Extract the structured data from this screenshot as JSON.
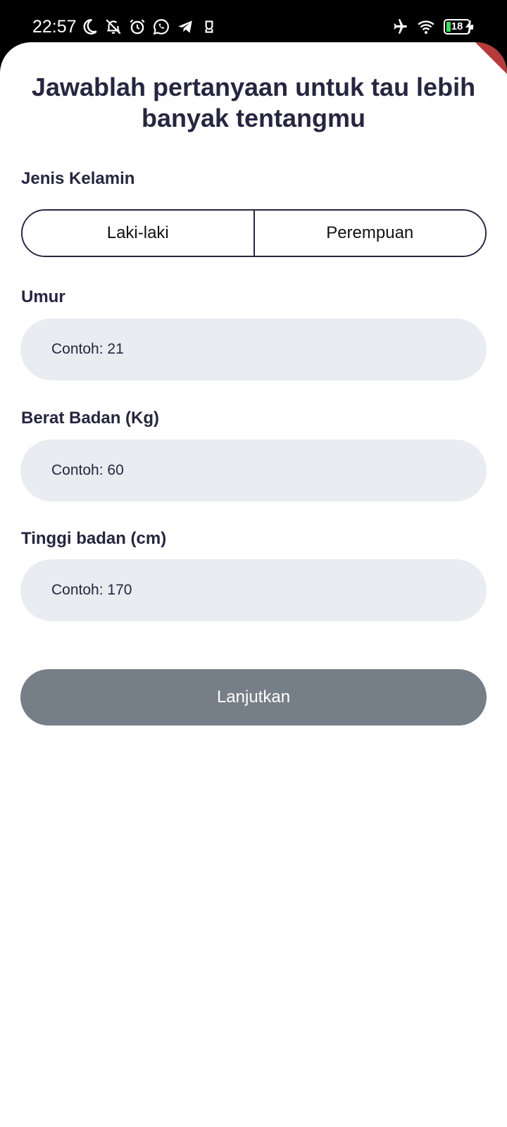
{
  "status_bar": {
    "time": "22:57",
    "left_icons": [
      "moon-icon",
      "bell-off-icon",
      "alarm-icon",
      "whatsapp-icon",
      "telegram-icon",
      "app-icon"
    ],
    "right_icons": [
      "airplane-icon",
      "wifi-icon",
      "battery-icon",
      "charging-icon"
    ],
    "battery_level": "18"
  },
  "page": {
    "title": "Jawablah pertanyaan untuk tau lebih banyak tentangmu"
  },
  "gender": {
    "label": "Jenis Kelamin",
    "options": [
      "Laki-laki",
      "Perempuan"
    ]
  },
  "age": {
    "label": "Umur",
    "placeholder": "Contoh: 21",
    "value": ""
  },
  "weight": {
    "label": "Berat Badan (Kg)",
    "placeholder": "Contoh: 60",
    "value": ""
  },
  "height": {
    "label": "Tinggi badan (cm)",
    "placeholder": "Contoh: 170",
    "value": ""
  },
  "actions": {
    "submit_label": "Lanjutkan"
  },
  "colors": {
    "text_primary": "#262640",
    "field_bg": "#e9ecf0",
    "button_disabled": "#767e87",
    "debug_ribbon": "#b73b3b"
  }
}
